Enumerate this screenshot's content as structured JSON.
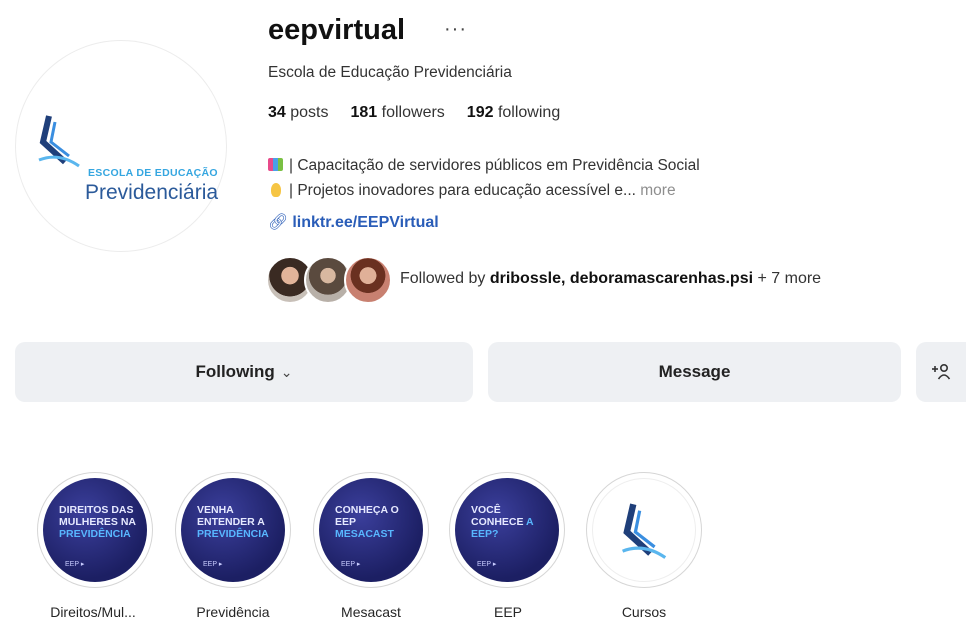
{
  "profile": {
    "username": "eepvirtual",
    "more_icon": "ellipsis-icon",
    "full_name": "Escola de Educação Previdenciária",
    "avatar": {
      "logo_top": "ESCOLA DE EDUCAÇÃO",
      "logo_main": "Previdenciária"
    }
  },
  "stats": {
    "posts_count": "34",
    "posts_label": "posts",
    "followers_count": "181",
    "followers_label": "followers",
    "following_count": "192",
    "following_label": "following"
  },
  "bio": {
    "line1": "| Capacitação de servidores públicos em Previdência Social",
    "line2": "| Projetos inovadores para educação acessível e...",
    "more": " more",
    "link_icon": "link-icon",
    "link": "linktr.ee/EEPVirtual"
  },
  "followed_by": {
    "prefix": "Followed by ",
    "names": "dribossle, deboramascarenhas.psi",
    "suffix": " + 7 more"
  },
  "actions": {
    "following_label": "Following",
    "following_chevron": "⌄",
    "message_label": "Message",
    "add_user_icon": "add-person-icon"
  },
  "highlights": [
    {
      "label": "Direitos/Mul...",
      "cover_line1": "DIREITOS DAS MULHERES NA",
      "cover_accent": "PREVIDÊNCIA",
      "cover_sub": "EEP ▸"
    },
    {
      "label": "Previdência",
      "cover_line1": "VENHA ENTENDER A",
      "cover_accent": "PREVIDÊNCIA",
      "cover_sub": "EEP ▸"
    },
    {
      "label": "Mesacast",
      "cover_line1": "CONHEÇA O EEP",
      "cover_accent": "MESACAST",
      "cover_sub": "EEP ▸"
    },
    {
      "label": "EEP",
      "cover_line1": "VOCÊ CONHECE",
      "cover_accent": "A EEP?",
      "cover_sub": "EEP ▸"
    },
    {
      "label": "Cursos"
    }
  ],
  "colors": {
    "link": "#2a5db8",
    "button_bg": "#eef0f3",
    "highlight_bg": "#1c1f63"
  }
}
